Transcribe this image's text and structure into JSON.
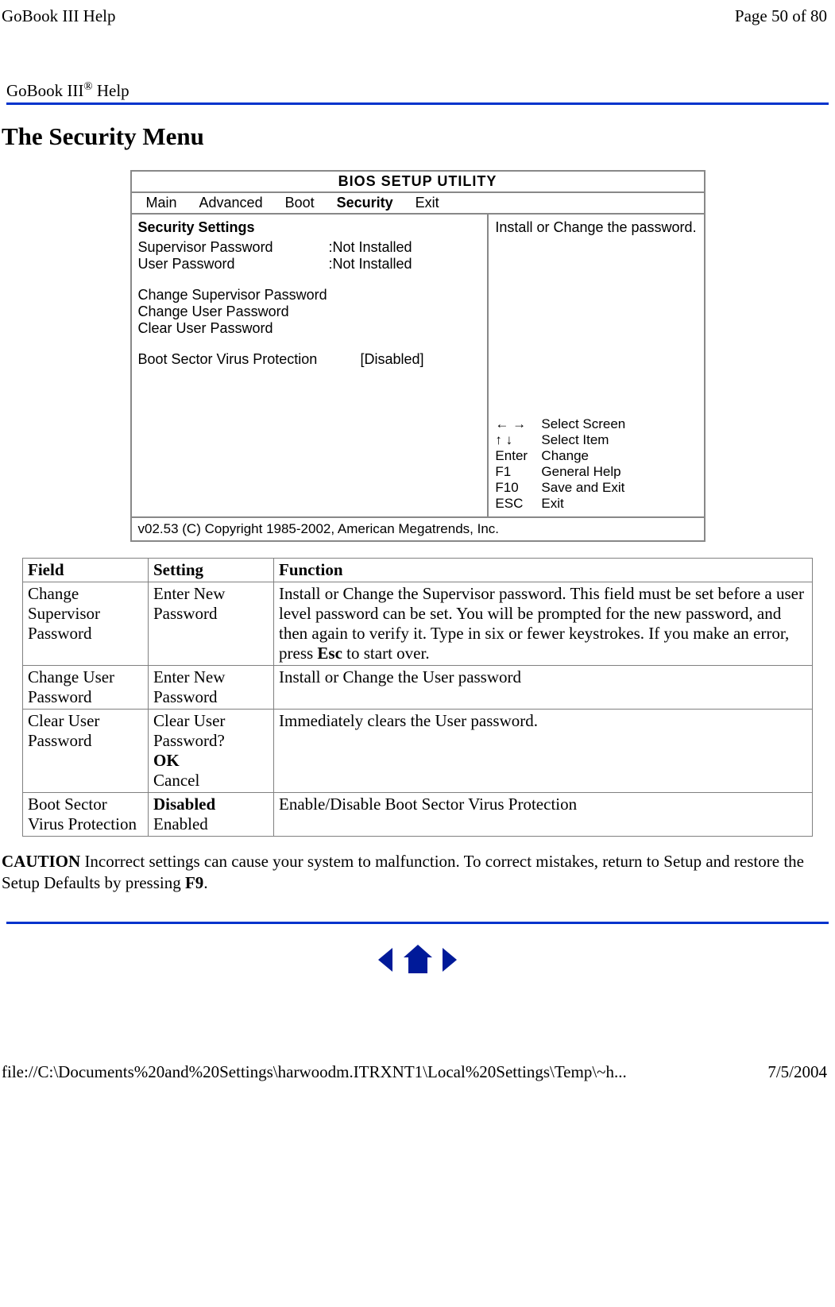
{
  "header": {
    "left": "GoBook III Help",
    "right": "Page 50 of 80"
  },
  "help_bar": {
    "prefix": "GoBook III",
    "sup": "®",
    "suffix": " Help"
  },
  "page_title": "The Security Menu",
  "bios": {
    "title": "BIOS   SETUP   UTILITY",
    "tabs": [
      "Main",
      "Advanced",
      "Boot",
      "Security",
      "Exit"
    ],
    "selected_tab": "Security",
    "left_heading": "Security Settings",
    "supervisor_label": "Supervisor Password",
    "supervisor_value": ":Not Installed",
    "user_label": "User Password",
    "user_value": ":Not Installed",
    "change_supervisor": "Change Supervisor Password",
    "change_user": "Change User Password",
    "clear_user": "Clear User Password",
    "boot_sector_label": "Boot Sector Virus Protection",
    "boot_sector_value": "[Disabled]",
    "right_help_top": "Install or Change the password.",
    "keys": [
      {
        "sym": "← →",
        "text": "Select Screen"
      },
      {
        "sym": "↑ ↓",
        "text": "Select Item"
      },
      {
        "sym": "Enter",
        "text": "Change"
      },
      {
        "sym": "F1",
        "text": "General Help"
      },
      {
        "sym": "F10",
        "text": "Save and Exit"
      },
      {
        "sym": "ESC",
        "text": "Exit"
      }
    ],
    "footer": "v02.53 (C) Copyright 1985-2002, American Megatrends, Inc."
  },
  "table": {
    "headers": [
      "Field",
      "Setting",
      "Function"
    ],
    "rows": [
      {
        "field": "Change Supervisor Password",
        "setting": "Enter New Password",
        "function_pre": "Install or Change the Supervisor password. This field must be set before a user level password can be set. You will be prompted for the new password, and then again to verify it.  Type in six or fewer keystrokes.  If you make an error, press ",
        "function_bold": "Esc",
        "function_post": " to start over."
      },
      {
        "field": "Change User Password",
        "setting": "Enter New Password",
        "function_pre": "Install or Change the User password",
        "function_bold": "",
        "function_post": ""
      },
      {
        "field": "Clear User Password",
        "setting_line1": "Clear User Password?",
        "setting_bold": "OK",
        "setting_line3": "Cancel",
        "function_pre": "Immediately clears the User password.",
        "function_bold": "",
        "function_post": ""
      },
      {
        "field": "Boot Sector Virus Protection",
        "setting_bold": "Disabled",
        "setting_line2": "Enabled",
        "function_pre": "Enable/Disable Boot Sector Virus Protection",
        "function_bold": "",
        "function_post": ""
      }
    ]
  },
  "caution": {
    "label": "CAUTION",
    "text_pre": "  Incorrect settings can cause your system to malfunction.  To correct mistakes, return to Setup and restore the Setup Defaults by pressing ",
    "key": "F9",
    "text_post": "."
  },
  "footer": {
    "left": "file://C:\\Documents%20and%20Settings\\harwoodm.ITRXNT1\\Local%20Settings\\Temp\\~h...",
    "right": "7/5/2004"
  }
}
